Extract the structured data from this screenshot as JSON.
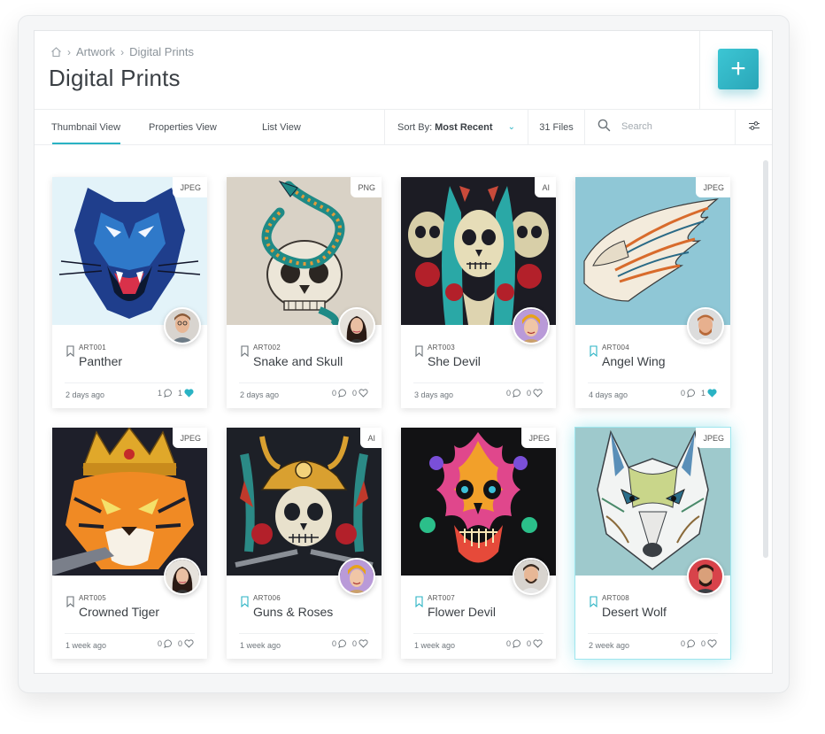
{
  "breadcrumb": {
    "home_icon": "home-icon",
    "items": [
      "Artwork",
      "Digital Prints"
    ]
  },
  "page": {
    "title": "Digital Prints"
  },
  "add_button": {
    "label": "+"
  },
  "tabs": [
    "Thumbnail View",
    "Properties View",
    "List View"
  ],
  "active_tab": "Thumbnail View",
  "sort": {
    "label": "Sort By:",
    "value": "Most Recent"
  },
  "files_count": "31 Files",
  "search": {
    "placeholder": "Search",
    "value": ""
  },
  "colors": {
    "accent": "#2ab3c4",
    "heart": "#2ab3c4"
  },
  "cards": [
    {
      "code": "ART001",
      "name": "Panther",
      "type": "JPEG",
      "age": "2 days ago",
      "comments": "1",
      "likes": "1",
      "liked": true,
      "bookmarked": false,
      "selected": false,
      "bg": "#e3f3f9"
    },
    {
      "code": "ART002",
      "name": "Snake and Skull",
      "type": "PNG",
      "age": "2 days ago",
      "comments": "0",
      "likes": "0",
      "liked": false,
      "bookmarked": false,
      "selected": false,
      "bg": "#d9d2c6"
    },
    {
      "code": "ART003",
      "name": "She Devil",
      "type": "AI",
      "age": "3 days ago",
      "comments": "0",
      "likes": "0",
      "liked": false,
      "bookmarked": false,
      "selected": false,
      "bg": "#1c1c24"
    },
    {
      "code": "ART004",
      "name": "Angel Wing",
      "type": "JPEG",
      "age": "4 days ago",
      "comments": "0",
      "likes": "1",
      "liked": true,
      "bookmarked": true,
      "selected": false,
      "bg": "#8fc7d6"
    },
    {
      "code": "ART005",
      "name": "Crowned Tiger",
      "type": "JPEG",
      "age": "1 week ago",
      "comments": "0",
      "likes": "0",
      "liked": false,
      "bookmarked": false,
      "selected": false,
      "bg": "#1e1f2a"
    },
    {
      "code": "ART006",
      "name": "Guns & Roses",
      "type": "AI",
      "age": "1 week ago",
      "comments": "0",
      "likes": "0",
      "liked": false,
      "bookmarked": true,
      "selected": false,
      "bg": "#1d2027"
    },
    {
      "code": "ART007",
      "name": "Flower Devil",
      "type": "JPEG",
      "age": "1 week ago",
      "comments": "0",
      "likes": "0",
      "liked": false,
      "bookmarked": true,
      "selected": false,
      "bg": "#121214"
    },
    {
      "code": "ART008",
      "name": "Desert Wolf",
      "type": "JPEG",
      "age": "2 week ago",
      "comments": "0",
      "likes": "0",
      "liked": false,
      "bookmarked": true,
      "selected": true,
      "bg": "#9ec9cc"
    }
  ]
}
